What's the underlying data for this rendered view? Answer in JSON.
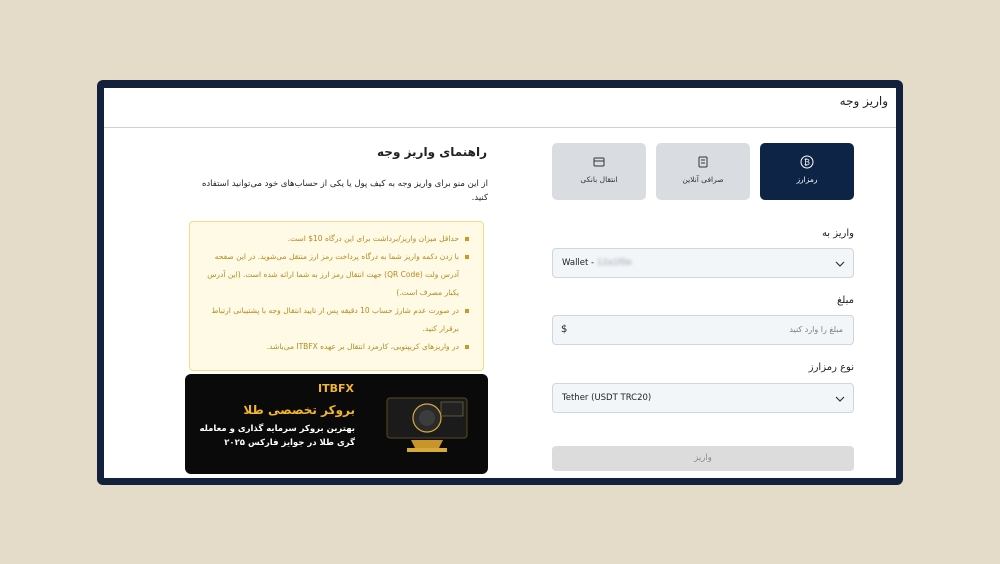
{
  "page": {
    "title": "واریز وجه"
  },
  "tabs": [
    {
      "label": "رمزارز",
      "icon": "bitcoin-icon",
      "active": true
    },
    {
      "label": "صرافی آنلاین",
      "icon": "exchange-office-icon",
      "active": false
    },
    {
      "label": "انتقال بانکی",
      "icon": "card-icon",
      "active": false
    }
  ],
  "form": {
    "deposit_to_label": "واریز به",
    "deposit_to_value": "Wallet -",
    "deposit_to_masked": "12a1f0e",
    "amount_label": "مبلغ",
    "amount_placeholder": "مبلغ را وارد کنید",
    "currency_symbol": "$",
    "crypto_type_label": "نوع رمزارز",
    "crypto_type_value": "Tether (USDT TRC20)",
    "submit_label": "واریز"
  },
  "guide": {
    "title": "راهنمای واریز وجه",
    "description": "از این منو برای واریز وجه به کیف پول یا یکی از حساب‌های خود می‌توانید استفاده کنید.",
    "notes": [
      "حداقل میزان واریز/برداشت برای این درگاه 10$ است.",
      "با زدن دکمه واریز شما به درگاه پرداخت رمز ارز منتقل می‌شوید. در این صفحه آدرس ولت (QR Code) جهت انتقال رمز ارز به شما ارائه شده است. (این آدرس یکبار مصرف است.)",
      "در صورت عدم شارژ حساب 10 دقیقه پس از تایید انتقال وجه با پشتیبانی ارتباط برقرار کنید.",
      "در واریزهای کریپتویی، کارمزد انتقال بر عهده ITBFX می‌باشد."
    ]
  },
  "banner": {
    "brand": "ITBFX",
    "headline": "بروکر تخصصی طلا",
    "subline": "بهترین بروکر سرمایه گذاری و معامله گری طلا در جوایز فارکس ۲۰۲۵"
  },
  "colors": {
    "active_tab": "#0e2446",
    "inactive_tab": "#d9dce1",
    "notice_bg": "#fffae6",
    "notice_text": "#b58b1d",
    "banner_gold": "#f2b62e",
    "frame": "#14213d"
  }
}
